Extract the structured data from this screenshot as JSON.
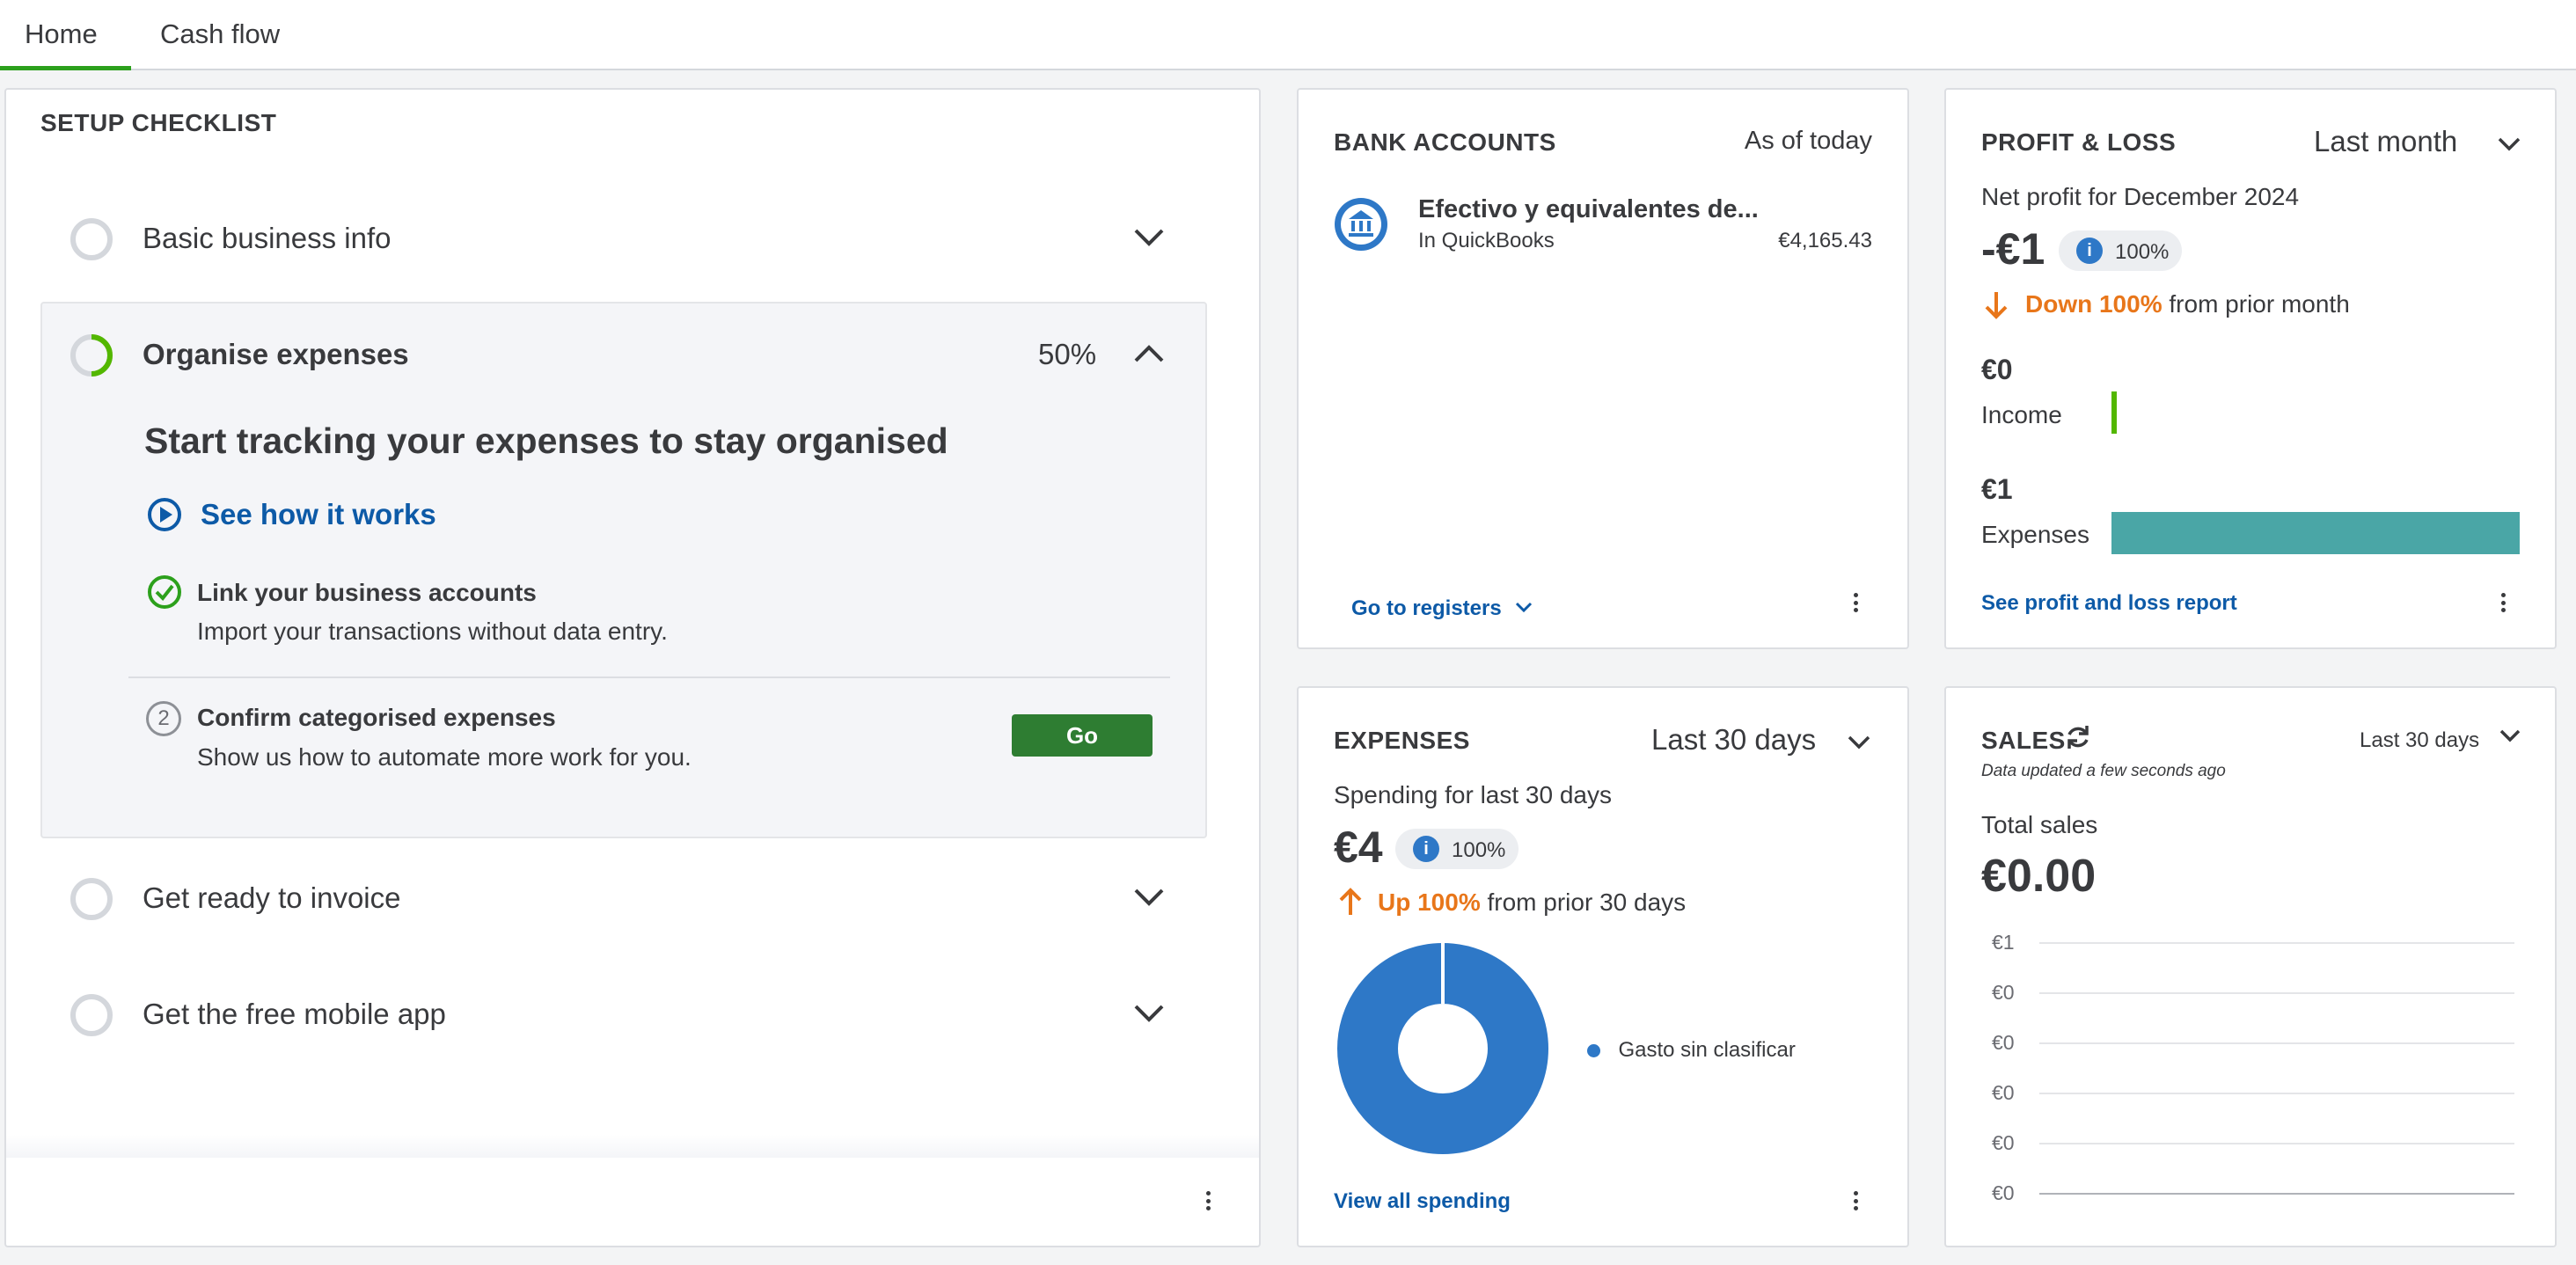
{
  "tabs": [
    {
      "label": "Home"
    },
    {
      "label": "Cash flow"
    }
  ],
  "setup_checklist": {
    "title": "SETUP CHECKLIST",
    "items": [
      {
        "label": "Basic business info"
      },
      {
        "label": "Organise expenses",
        "progress_label": "50%",
        "progress": 0.5
      },
      {
        "label": "Get ready to invoice"
      },
      {
        "label": "Get the free mobile app"
      }
    ],
    "expanded": {
      "heading": "Start tracking your expenses to stay organised",
      "video_link": "See how it works",
      "tasks": [
        {
          "title": "Link your business accounts",
          "description": "Import your transactions without data entry.",
          "status": "done"
        },
        {
          "title": "Confirm categorised expenses",
          "description": "Show us how to automate more work for you.",
          "step": "2",
          "button": "Go"
        }
      ]
    }
  },
  "bank_accounts": {
    "title": "BANK ACCOUNTS",
    "as_of": "As of today",
    "account_name": "Efectivo y equivalentes de...",
    "account_source": "In QuickBooks",
    "account_balance": "€4,165.43",
    "footer_link": "Go to registers"
  },
  "profit_loss": {
    "title": "PROFIT & LOSS",
    "period": "Last month",
    "net_label": "Net profit for December 2024",
    "net_value": "-€1",
    "info_pct": "100%",
    "change_text": "Down 100%",
    "change_suffix": "from prior month",
    "income_value": "€0",
    "income_label": "Income",
    "expenses_value": "€1",
    "expenses_label": "Expenses",
    "income_fraction": 0,
    "expenses_fraction": 1,
    "footer_link": "See profit and loss report",
    "colors": {
      "income": "#53b700",
      "expenses": "#4aa6a6",
      "down": "#e8761a"
    }
  },
  "expenses": {
    "title": "EXPENSES",
    "period": "Last 30 days",
    "spending_label": "Spending for last 30 days",
    "value": "€4",
    "info_pct": "100%",
    "change_text": "Up 100%",
    "change_suffix": "from prior 30 days",
    "legend": "Gasto sin clasificar",
    "footer_link": "View all spending",
    "colors": {
      "slice": "#2e78c7",
      "up": "#e8761a"
    }
  },
  "sales": {
    "title": "SALES",
    "updated": "Data updated a few seconds ago",
    "period": "Last 30 days",
    "total_label": "Total sales",
    "total_value": "€0.00",
    "y_ticks": [
      "€1",
      "€0",
      "€0",
      "€0",
      "€0",
      "€0"
    ]
  },
  "chart_data": [
    {
      "type": "pie",
      "title": "",
      "categories": [
        "Gasto sin clasificar"
      ],
      "values": [
        4
      ]
    },
    {
      "type": "bar",
      "title": "",
      "categories": [
        "Income",
        "Expenses"
      ],
      "values": [
        0,
        1
      ]
    },
    {
      "type": "line",
      "title": "",
      "ytick_labels": [
        "€1",
        "€0",
        "€0",
        "€0",
        "€0",
        "€0"
      ],
      "series": []
    }
  ]
}
